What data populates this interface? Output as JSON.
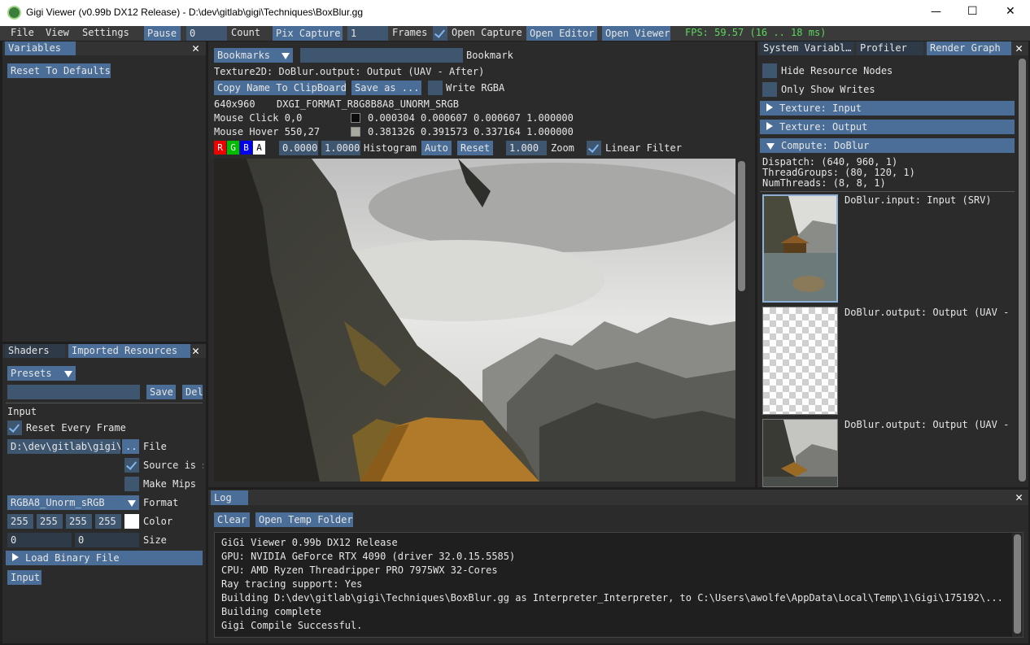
{
  "window": {
    "title": "Gigi Viewer (v0.99b DX12 Release) - D:\\dev\\gitlab\\gigi\\Techniques\\BoxBlur.gg",
    "minimize": "—",
    "maximize": "☐",
    "close": "✕"
  },
  "menu": {
    "file": "File",
    "view": "View",
    "settings": "Settings"
  },
  "toolbar": {
    "pause": "Pause",
    "count_value": "0",
    "count_label": "Count",
    "pix_capture": "Pix Capture",
    "frames_value": "1",
    "frames_label": "Frames",
    "open_capture": "Open Capture",
    "open_editor": "Open Editor",
    "open_viewer": "Open Viewer",
    "fps": "FPS: 59.57 (16 .. 18 ms)"
  },
  "variables_panel": {
    "tab": "Variables",
    "reset": "Reset To Defaults"
  },
  "resources_panel": {
    "tabs": [
      "Shaders",
      "Imported Resources"
    ],
    "presets": "Presets",
    "save": "Save",
    "delete": "Del",
    "section": "Input",
    "reset_every_frame": "Reset Every Frame",
    "file_path": "D:\\dev\\gitlab\\gigi\\Te",
    "file_browse": "..",
    "file_label": "File",
    "source_is": "Source is s",
    "make_mips": "Make Mips",
    "format_value": "RGBA8_Unorm_sRGB",
    "format_label": "Format",
    "color_values": [
      "255",
      "255",
      "255",
      "255"
    ],
    "color_label": "Color",
    "size_values": [
      "0",
      "0"
    ],
    "size_label": "Size",
    "load_binary": "Load Binary File",
    "input_button": "Input"
  },
  "viewer": {
    "bookmarks": "Bookmarks",
    "bookmark_label": "Bookmark",
    "texture_name": "Texture2D: DoBlur.output: Output (UAV - After)",
    "copy_name": "Copy Name To ClipBoard",
    "save_as": "Save as ...",
    "write_rgba": "Write RGBA",
    "dims": "640x960",
    "format": "DXGI_FORMAT_R8G8B8A8_UNORM_SRGB",
    "mouse_click_label": "Mouse Click 0,0",
    "mouse_click_values": "0.000304 0.000607 0.000607 1.000000",
    "mouse_hover_label": "Mouse Hover 550,27",
    "mouse_hover_values": "0.381326 0.391573 0.337164 1.000000",
    "channels": [
      "R",
      "G",
      "B",
      "A"
    ],
    "hist_min": "0.0000",
    "hist_max": "1.0000",
    "histogram": "Histogram",
    "auto": "Auto",
    "reset": "Reset",
    "zoom_value": "1.000",
    "zoom_label": "Zoom",
    "linear_filter": "Linear Filter",
    "click_swatch": "#0b0b0b",
    "hover_swatch": "#aaa99f"
  },
  "right_panel": {
    "tabs": [
      "System Variabl…",
      "Profiler",
      "Render Graph"
    ],
    "hide_resource_nodes": "Hide Resource Nodes",
    "only_show_writes": "Only Show Writes",
    "nodes": [
      "Texture: Input",
      "Texture: Output",
      "Compute: DoBlur"
    ],
    "dispatch": "Dispatch: (640, 960, 1)",
    "threadgroups": "ThreadGroups: (80, 120, 1)",
    "numthreads": "NumThreads: (8, 8, 1)",
    "resources": [
      "DoBlur.input: Input (SRV)",
      "DoBlur.output: Output (UAV - B",
      "DoBlur.output: Output (UAV - A"
    ]
  },
  "log_panel": {
    "tab": "Log",
    "clear": "Clear",
    "open_temp": "Open Temp Folder",
    "lines": [
      "GiGi Viewer 0.99b DX12 Release",
      "GPU: NVIDIA GeForce RTX 4090 (driver 32.0.15.5585)",
      "CPU: AMD Ryzen Threadripper PRO 7975WX 32-Cores",
      "Ray tracing support: Yes",
      "Building D:\\dev\\gitlab\\gigi\\Techniques\\BoxBlur.gg as Interpreter_Interpreter, to C:\\Users\\awolfe\\AppData\\Local\\Temp\\1\\Gigi\\175192\\...",
      "Building complete",
      "Gigi Compile Successful."
    ]
  },
  "colors": {
    "accent": "#4a6e97",
    "fps": "#5ad85a",
    "panel_bg": "#2b2b2b"
  }
}
